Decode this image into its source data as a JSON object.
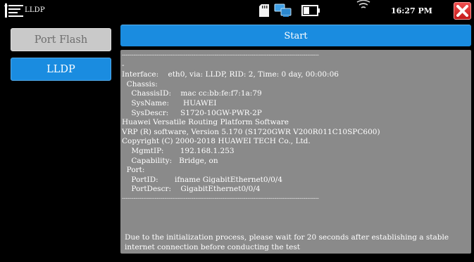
{
  "titlebar": {
    "app_title": "LLDP",
    "icons": [
      "app-logo-icon",
      "sd-card-icon",
      "network-icon",
      "battery-icon",
      "wifi-icon"
    ],
    "time": "16:27 PM",
    "close_icon": "close-icon",
    "close_color": "#d42020"
  },
  "sidebar": {
    "items": [
      {
        "label": "Port Flash",
        "state": "disabled"
      },
      {
        "label": "LLDP",
        "state": "active"
      }
    ]
  },
  "toolbar": {
    "start_label": "Start"
  },
  "colors": {
    "accent": "#1a8ce0",
    "panel_bg": "#8a8a8a",
    "disabled_btn": "#c9c9c9",
    "background": "#000000"
  },
  "output": {
    "separator": "------------------------------------------------------------------------------------------------------",
    "lines": [
      "-",
      "Interface:    eth0, via: LLDP, RID: 2, Time: 0 day, 00:00:06",
      "  Chassis:",
      "    ChassisID:    mac cc:bb:fe:f7:1a:79",
      "    SysName:      HUAWEI",
      "    SysDescr:     S1720-10GW-PWR-2P",
      "Huawei Versatile Routing Platform Software",
      "VRP (R) software, Version 5.170 (S1720GWR V200R011C10SPC600)",
      "Copyright (C) 2000-2018 HUAWEI TECH Co., Ltd.",
      "    MgmtIP:       192.168.1.253",
      "    Capability:   Bridge, on",
      "  Port:",
      "    PortID:       ifname GigabitEthernet0/0/4",
      "    PortDescr:    GigabitEthernet0/0/4"
    ],
    "notice": "Due to the initialization process, please wait for 20 seconds after establishing a stable internet connection before conducting the test"
  }
}
